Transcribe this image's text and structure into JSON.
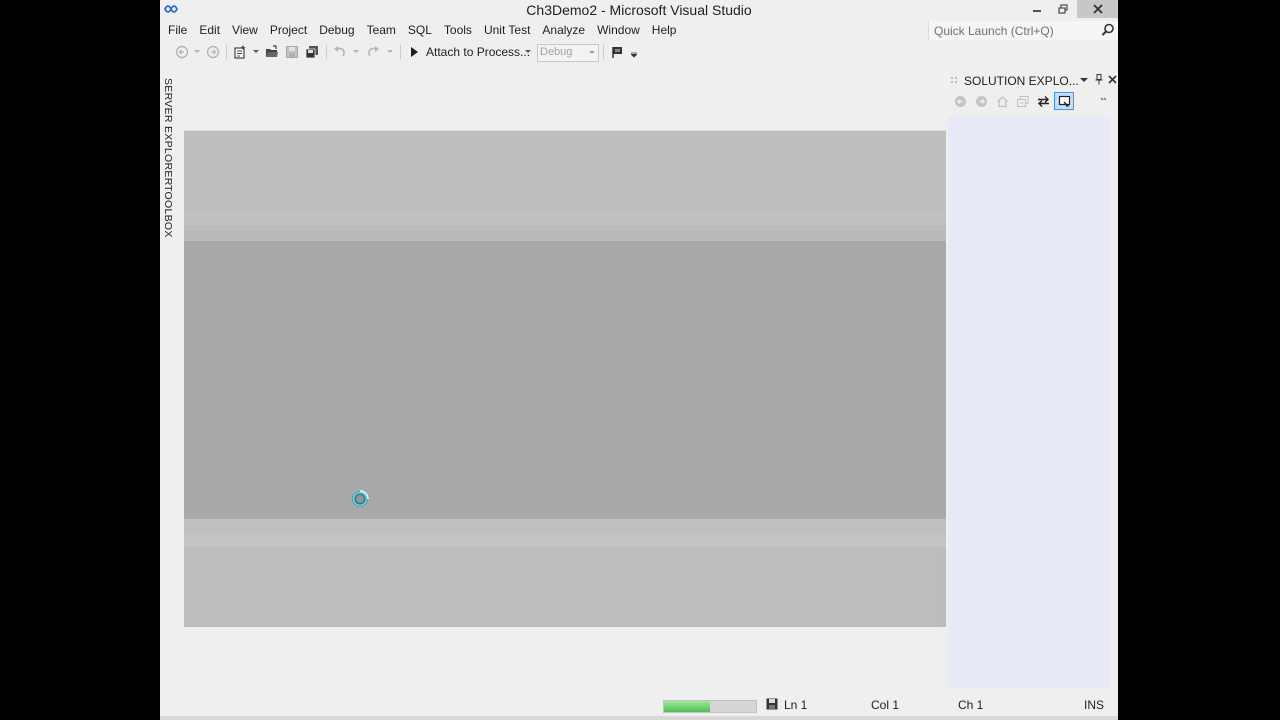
{
  "window": {
    "title": "Ch3Demo2 - Microsoft Visual Studio"
  },
  "menu": {
    "items": [
      {
        "label": "File"
      },
      {
        "label": "Edit"
      },
      {
        "label": "View"
      },
      {
        "label": "Project"
      },
      {
        "label": "Debug"
      },
      {
        "label": "Team"
      },
      {
        "label": "SQL"
      },
      {
        "label": "Tools"
      },
      {
        "label": "Unit Test"
      },
      {
        "label": "Analyze"
      },
      {
        "label": "Window"
      },
      {
        "label": "Help"
      }
    ]
  },
  "quick_launch": {
    "placeholder": "Quick Launch (Ctrl+Q)"
  },
  "toolbar": {
    "attach_label": "Attach to Process...",
    "configuration": "Debug"
  },
  "left_tabs": {
    "server_explorer": "SERVER EXPLORER",
    "toolbox": "TOOLBOX"
  },
  "solution_explorer": {
    "title": "SOLUTION EXPLO..."
  },
  "status": {
    "progress": 0.5,
    "line": "Ln 1",
    "col": "Col 1",
    "ch": "Ch 1",
    "mode": "INS"
  },
  "colors": {
    "accent": "#3399ff",
    "progress": "#4fc04f",
    "close_button": "#c7c7c7",
    "panel_bg": "#e8eaf8"
  }
}
